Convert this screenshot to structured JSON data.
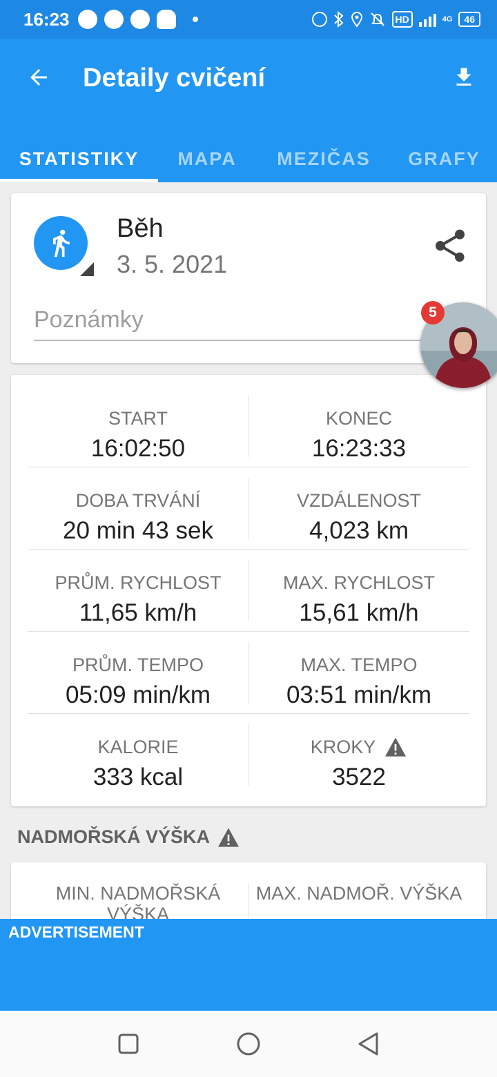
{
  "status_bar": {
    "time": "16:23",
    "hd": "HD",
    "network": "4G",
    "battery": "46"
  },
  "appbar": {
    "title": "Detaily cvičení"
  },
  "tabs": [
    {
      "label": "STATISTIKY",
      "active": true
    },
    {
      "label": "MAPA",
      "active": false
    },
    {
      "label": "MEZIČAS",
      "active": false
    },
    {
      "label": "GRAFY",
      "active": false
    }
  ],
  "activity": {
    "name": "Běh",
    "date": "3. 5. 2021",
    "notes_placeholder": "Poznámky"
  },
  "stats": [
    {
      "label": "START",
      "value": "16:02:50"
    },
    {
      "label": "KONEC",
      "value": "16:23:33"
    },
    {
      "label": "DOBA TRVÁNÍ",
      "value": "20 min 43 sek"
    },
    {
      "label": "VZDÁLENOST",
      "value": "4,023 km"
    },
    {
      "label": "PRŮM. RYCHLOST",
      "value": "11,65 km/h"
    },
    {
      "label": "MAX. RYCHLOST",
      "value": "15,61 km/h"
    },
    {
      "label": "PRŮM. TEMPO",
      "value": "05:09 min/km"
    },
    {
      "label": "MAX. TEMPO",
      "value": "03:51 min/km"
    },
    {
      "label": "KALORIE",
      "value": "333 kcal"
    },
    {
      "label": "KROKY",
      "value": "3522"
    }
  ],
  "altitude": {
    "section_title": "NADMOŘSKÁ VÝŠKA",
    "min_label": "MIN. NADMOŘSKÁ VÝŠKA",
    "max_label": "MAX. NADMOŘ. VÝŠKA"
  },
  "ad": {
    "label": "ADVERTISEMENT"
  },
  "chat_head": {
    "badge_count": "5"
  },
  "colors": {
    "primary": "#2196f3",
    "status_bar": "#1e88e5",
    "badge": "#e53935"
  }
}
